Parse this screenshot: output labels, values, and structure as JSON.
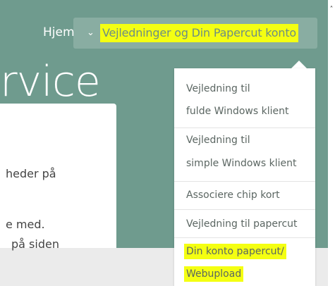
{
  "nav": {
    "home_label": "Hjem",
    "dropdown_label": "Vejledninger og Din Papercut konto",
    "highlight_color": "#f4ff12"
  },
  "hero": {
    "title_fragment": "rvice",
    "background_color": "#6f9b8e"
  },
  "content": {
    "lines": [
      "heder på",
      "e med.",
      "på siden"
    ]
  },
  "menu": {
    "items": [
      {
        "lines": [
          "Vejledning til",
          "fulde Windows klient"
        ]
      },
      {
        "lines": [
          "Vejledning til",
          "simple Windows klient"
        ]
      },
      {
        "lines": [
          "Associere chip kort"
        ]
      },
      {
        "lines": [
          "Vejledning til papercut"
        ]
      },
      {
        "lines": [
          "Din konto papercut/",
          "Webupload"
        ],
        "highlighted": true
      }
    ]
  }
}
